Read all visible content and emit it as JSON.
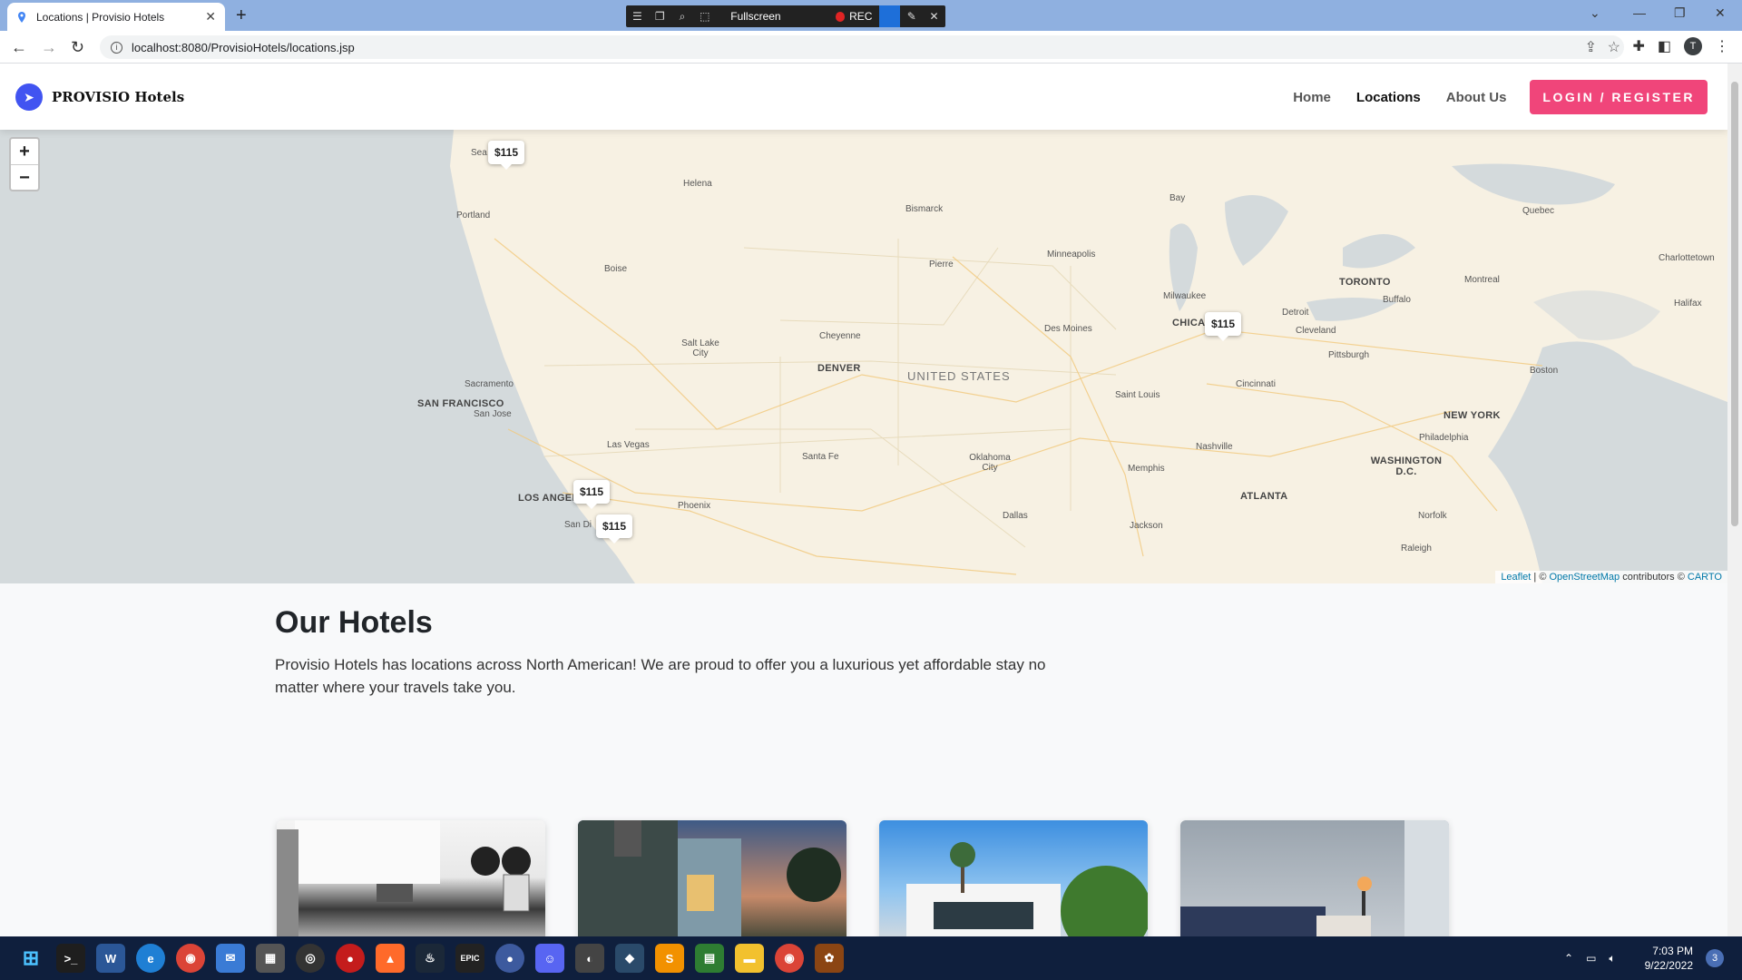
{
  "browser": {
    "tab_title": "Locations | Provisio Hotels",
    "url": "localhost:8080/ProvisioHotels/locations.jsp",
    "profile_initial": "T"
  },
  "recorder": {
    "mode_label": "Fullscreen",
    "rec_label": "REC"
  },
  "site": {
    "brand": "PROVISIO Hotels",
    "nav": [
      "Home",
      "Locations",
      "About Us"
    ],
    "active_nav": "Locations",
    "login_label": "LOGIN / REGISTER"
  },
  "map": {
    "country_label": "UNITED STATES",
    "cities": [
      "Sea",
      "Portland",
      "Helena",
      "Boise",
      "Salt Lake City",
      "Sacramento",
      "SAN FRANCISCO",
      "San Jose",
      "Las Vegas",
      "LOS ANGEL",
      "San Di",
      "Phoenix",
      "Cheyenne",
      "DENVER",
      "Santa Fe",
      "Bismarck",
      "Pierre",
      "Minneapolis",
      "Des Moines",
      "Oklahoma City",
      "Dallas",
      "Bay",
      "Milwaukee",
      "CHICA",
      "Saint Louis",
      "Memphis",
      "Nashville",
      "Jackson",
      "ATLANTA",
      "Detroit",
      "Cleveland",
      "Cincinnati",
      "Pittsburgh",
      "TORONTO",
      "Buffalo",
      "Quebec",
      "Montreal",
      "Charlottetown",
      "Halifax",
      "Boston",
      "NEW YORK",
      "Philadelphia",
      "WASHINGTON D.C.",
      "Norfolk",
      "Raleigh"
    ],
    "markers": [
      "$115",
      "$115",
      "$115",
      "$115"
    ],
    "zoom_in": "+",
    "zoom_out": "−",
    "attribution": {
      "leaflet": "Leaflet",
      "sep": " | © ",
      "osm": "OpenStreetMap",
      "contributors": " contributors © ",
      "carto": "CARTO"
    }
  },
  "content": {
    "heading": "Our Hotels",
    "description": "Provisio Hotels has locations across North American! We are proud to offer you a luxurious yet affordable stay no matter where your travels take you."
  },
  "taskbar": {
    "time": "7:03 PM",
    "date": "9/22/2022",
    "notification_count": "3"
  }
}
